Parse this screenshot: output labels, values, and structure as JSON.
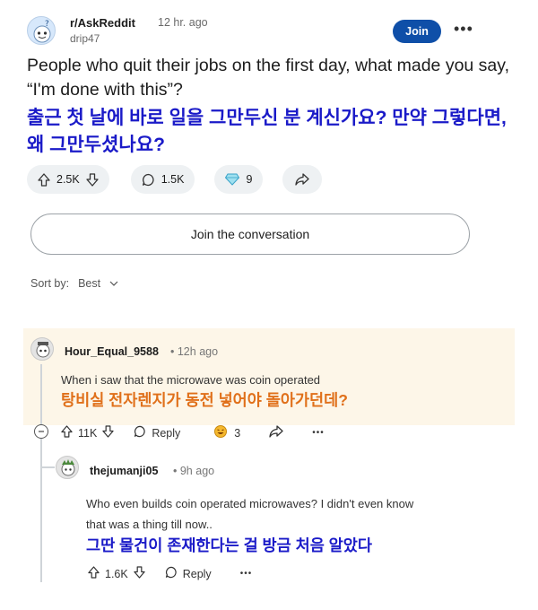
{
  "post": {
    "subreddit": "r/AskReddit",
    "time": "12 hr. ago",
    "author": "drip47",
    "join_label": "Join",
    "more_label": "•••",
    "title_en": "People who quit their jobs on the first day, what made you say, “I'm done with this”?",
    "title_ko": "출근 첫 날에 바로 일을 그만두신 분 계신가요? 만약 그렇다면, 왜 그만두셨나요?",
    "upvotes": "2.5K",
    "comments": "1.5K",
    "awards": "9"
  },
  "conversation_label": "Join the conversation",
  "sort": {
    "label": "Sort by:",
    "value": "Best"
  },
  "comments": [
    {
      "user": "Hour_Equal_9588",
      "time": "12h ago",
      "text": "When i saw that the microwave was coin operated",
      "text_ko": "탕비실 전자렌지가 동전 넣어야 돌아가던데?",
      "votes": "11K",
      "reply_label": "Reply",
      "awards": "3",
      "more_label": "•••"
    },
    {
      "user": "thejumanji05",
      "time": "9h ago",
      "text": "Who even builds coin operated microwaves? I didn't even know that was a thing till now..",
      "text_ko": "그딴 물건이 존재한다는 걸 방금 처음 알았다",
      "votes": "1.6K",
      "reply_label": "Reply",
      "more_label": "•••"
    }
  ],
  "colors": {
    "join_button": "#0f4fa8",
    "korean_title": "#1a1ac8",
    "korean_comment_1": "#e0701a",
    "korean_comment_2": "#1a1ac8",
    "highlight_bg": "#fdf6e8"
  }
}
